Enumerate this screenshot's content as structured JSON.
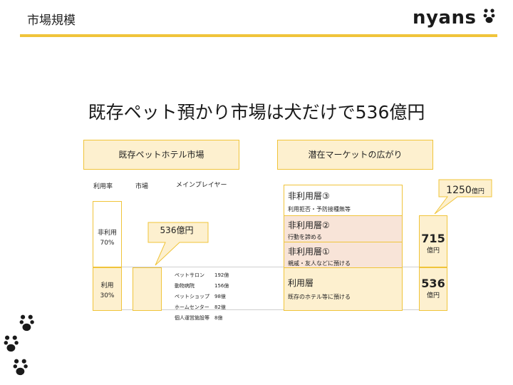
{
  "header": {
    "title": "市場規模",
    "logo": "nyans"
  },
  "main_title": "既存ペット預かり市場は犬だけで536億円",
  "left_section": {
    "heading": "既存ペットホテル市場",
    "col_labels": {
      "rate": "利用率",
      "market": "市場",
      "players": "メインプレイヤー"
    },
    "non_use": {
      "label": "非利用",
      "pct": "70%"
    },
    "use": {
      "label": "利用",
      "pct": "30%"
    },
    "callout": "536億円",
    "players": [
      {
        "name": "ペットサロン",
        "value": "192億"
      },
      {
        "name": "動物病院",
        "value": "156億"
      },
      {
        "name": "ペットショップ",
        "value": "98億"
      },
      {
        "name": "ホームセンター",
        "value": "82億"
      },
      {
        "name": "個人運営施設等",
        "value": "8億"
      }
    ]
  },
  "right_section": {
    "heading": "潜在マーケットの広がり",
    "tiers": [
      {
        "title": "非利用層③",
        "desc": "利用拒否・予防接種無等"
      },
      {
        "title": "非利用層②",
        "desc": "行動を諦める"
      },
      {
        "title": "非利用層①",
        "desc": "親戚・友人などに預ける"
      },
      {
        "title": "利用層",
        "desc": "既存のホテル等に預ける"
      }
    ],
    "total_callout": {
      "value": "1250",
      "unit": "億円"
    },
    "upper_col": {
      "value": "715",
      "unit": "億円"
    },
    "lower_col": {
      "value": "536",
      "unit": "億円"
    }
  },
  "colors": {
    "accent": "#f0c43a",
    "fill": "#fdf0cf",
    "tier_fill": "#f8e4d8"
  },
  "icons": [
    "paw-icon",
    "paw-icon",
    "paw-icon",
    "paw-icon"
  ]
}
